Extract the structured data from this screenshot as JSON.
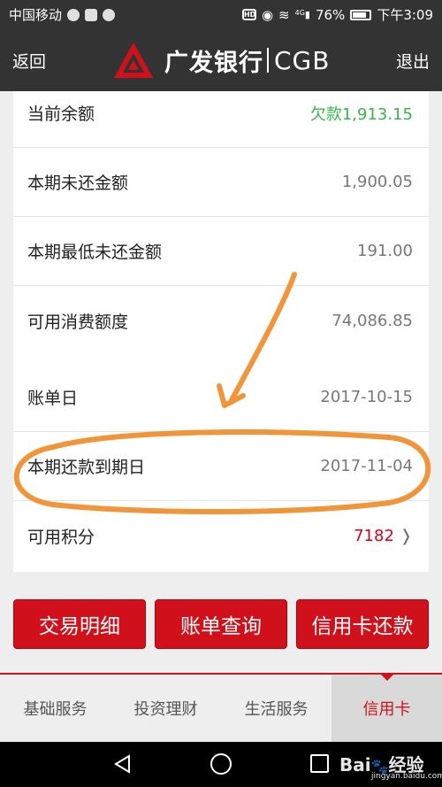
{
  "status_bar": {
    "carrier": "中国移动",
    "signal_label": "4G",
    "battery": "76%",
    "time": "下午3:09",
    "hd_badge": "HD"
  },
  "header": {
    "back_label": "返回",
    "bank_name": "广发银行",
    "bank_code": "CGB",
    "exit_label": "退出"
  },
  "balance_card": {
    "rows": [
      {
        "label": "当前余额",
        "value": "欠款1,913.15"
      },
      {
        "label": "本期未还金额",
        "value": "1,900.05"
      },
      {
        "label": "本期最低未还金额",
        "value": "191.00"
      },
      {
        "label": "可用消费额度",
        "value": "74,086.85"
      }
    ]
  },
  "statement_card": {
    "rows": [
      {
        "label": "账单日",
        "value": "2017-10-15"
      },
      {
        "label": "本期还款到期日",
        "value": "2017-11-04"
      },
      {
        "label": "可用积分",
        "value": "7182"
      }
    ]
  },
  "actions": {
    "transactions": "交易明细",
    "statements": "账单查询",
    "repay": "信用卡还款"
  },
  "tabs": [
    {
      "label": "基础服务"
    },
    {
      "label": "投资理财"
    },
    {
      "label": "生活服务"
    },
    {
      "label": "信用卡"
    }
  ],
  "watermark": {
    "brand": "Bai",
    "sub": "jingyan.baidu.com",
    "text": "经验"
  },
  "colors": {
    "accent": "#d0111b",
    "negative_balance": "#39b54a",
    "points": "#d0021b",
    "annotation": "#f0953a"
  },
  "icons": {
    "logo": "cgb-logo-icon",
    "points_arrow": "chevron-right-icon"
  }
}
